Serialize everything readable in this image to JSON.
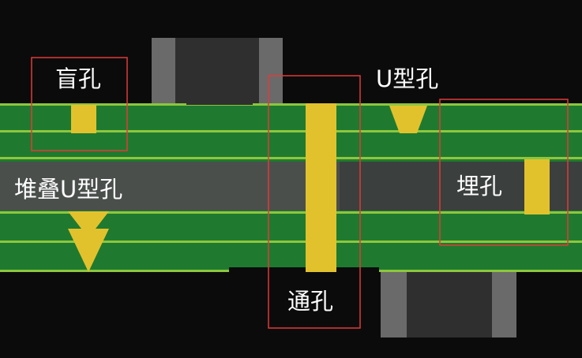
{
  "labels": {
    "blind_via": "盲孔",
    "stacked_u_via": "堆叠U型孔",
    "u_via": "U型孔",
    "through_via": "通孔",
    "buried_via": "埋孔"
  },
  "colors": {
    "background": "#0b0b0b",
    "board_green": "#1f7a2f",
    "trace_green": "#8dc63f",
    "core_gray": "#4a4f4c",
    "via_yellow": "#e2c22c",
    "component_dark": "#2e2e2e",
    "component_gray": "#6a6a6a",
    "highlight_red": "#e23a3a",
    "text": "#ffffff"
  }
}
